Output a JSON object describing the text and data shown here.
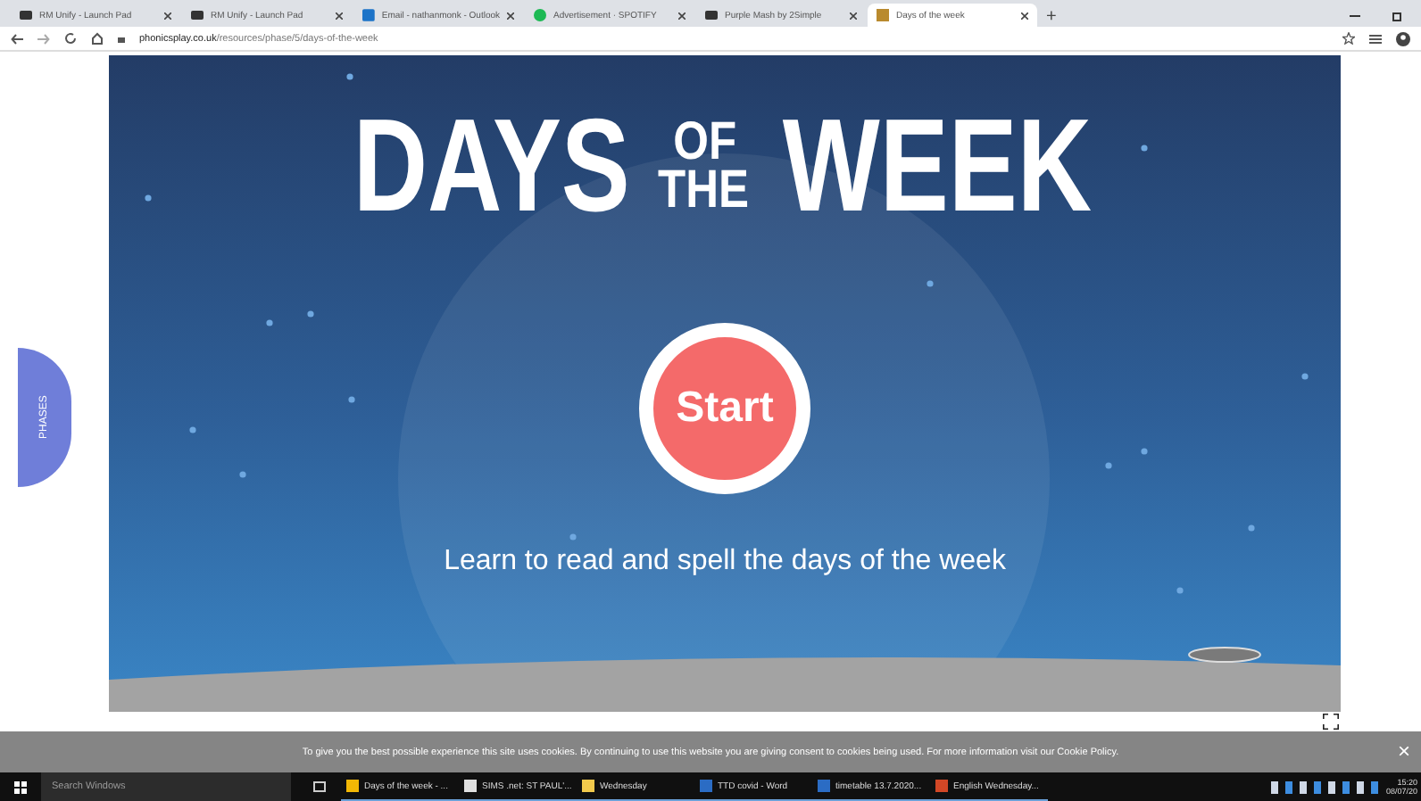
{
  "browser": {
    "tabs": [
      {
        "title": "RM Unify - Launch Pad",
        "selected": false,
        "kind": "bar"
      },
      {
        "title": "RM Unify - Launch Pad",
        "selected": false,
        "kind": "bar"
      },
      {
        "title": "Email - nathanmonk - Outlook",
        "selected": false,
        "kind": "mail"
      },
      {
        "title": "Advertisement · SPOTIFY",
        "selected": false,
        "kind": "circle"
      },
      {
        "title": "Purple Mash by 2Simple",
        "selected": false,
        "kind": "bar"
      },
      {
        "title": "Days of the week",
        "selected": true,
        "kind": "square"
      }
    ],
    "new_tab": "+",
    "url_host": "phonicsplay.co.uk",
    "url_path": "/resources/phase/5/days-of-the-week"
  },
  "game": {
    "title": {
      "big_left": "DAYS",
      "small_top": "OF",
      "small_bottom": "THE",
      "big_right": "WEEK"
    },
    "start_button": "Start",
    "subtitle": "Learn to read and spell the days of the week"
  },
  "phases_tab": "PHASES",
  "cookie_banner": {
    "text": "To give you the best possible experience this site uses cookies. By continuing to use this website you are giving consent to cookies being used. For more information visit our Cookie Policy.",
    "close": "×"
  },
  "taskbar": {
    "search_placeholder": "Search Windows",
    "apps": [
      {
        "label": "Days of the week - ...",
        "color": "#f2b705"
      },
      {
        "label": "SIMS .net: ST PAUL'...",
        "color": "#e0e0e0"
      },
      {
        "label": "Wednesday",
        "color": "#f2c94c"
      },
      {
        "label": "TTD covid - Word",
        "color": "#2b6cc4"
      },
      {
        "label": "timetable 13.7.2020...",
        "color": "#2b6cc4"
      },
      {
        "label": "English Wednesday...",
        "color": "#d24726"
      }
    ],
    "time": "15:20",
    "date": "08/07/20"
  }
}
